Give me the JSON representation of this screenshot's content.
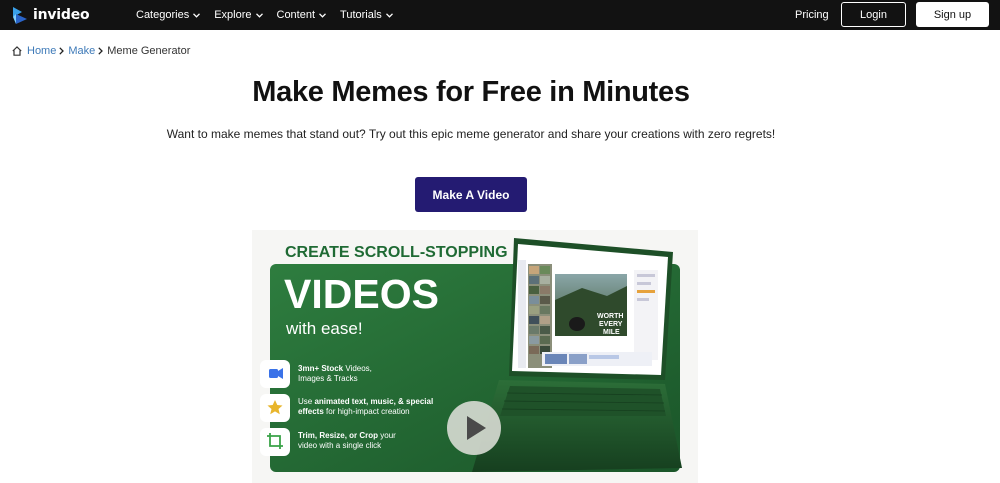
{
  "navbar": {
    "brand": "invideo",
    "menu": [
      {
        "label": "Categories"
      },
      {
        "label": "Explore"
      },
      {
        "label": "Content"
      },
      {
        "label": "Tutorials"
      }
    ],
    "pricing": "Pricing",
    "login": "Login",
    "signup": "Sign up"
  },
  "breadcrumb": {
    "home": "Home",
    "make": "Make",
    "current": "Meme Generator"
  },
  "hero": {
    "title": "Make Memes for Free in Minutes",
    "subtitle": "Want to make memes that stand out? Try out this epic meme generator and share your creations with zero regrets!",
    "cta": "Make A Video"
  },
  "banner": {
    "headline_small": "CREATE SCROLL-STOPPING",
    "headline_big": "VIDEOS",
    "headline_tail": "with ease!",
    "features": [
      {
        "icon": "video-camera-icon",
        "bold": "3mn+ Stock",
        "line1_rest": " Videos,",
        "line2": "Images & Tracks"
      },
      {
        "icon": "star-icon",
        "pre": "Use ",
        "bold": "animated text, music, & special",
        "line2_bold": "effects",
        "line2_rest": " for high-impact creation"
      },
      {
        "icon": "crop-icon",
        "bold": "Trim, Resize, or Crop",
        "line1_rest": " your",
        "line2": "video with a single click"
      }
    ],
    "screen_text": [
      "WORTH",
      "EVERY",
      "MILE"
    ],
    "colors": {
      "green_dark": "#1c5a2c",
      "green": "#2a7a3b",
      "headline": "#1f6a34"
    }
  },
  "colors": {
    "navbar": "#121212",
    "link": "#3e7ab8",
    "cta": "#241b72"
  }
}
